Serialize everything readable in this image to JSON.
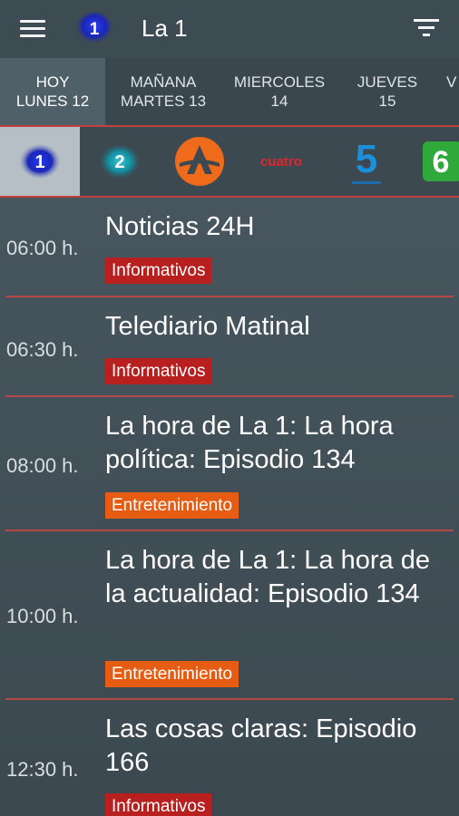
{
  "header": {
    "title": "La 1",
    "logo_number": "1",
    "menu_icon": "hamburger-menu-icon",
    "filter_icon": "filter-icon"
  },
  "day_tabs": [
    {
      "line1": "HOY",
      "line2": "LUNES 12",
      "active": true
    },
    {
      "line1": "MAÑANA",
      "line2": "MARTES 13",
      "active": false
    },
    {
      "line1": "MIERCOLES",
      "line2": "14",
      "active": false
    },
    {
      "line1": "JUEVES",
      "line2": "15",
      "active": false
    },
    {
      "line1": "V",
      "line2": "",
      "active": false
    }
  ],
  "channels": [
    {
      "name": "la1-logo",
      "label": "1",
      "active": true
    },
    {
      "name": "la2-logo",
      "label": "2",
      "active": false
    },
    {
      "name": "antena3-logo",
      "label": "",
      "active": false
    },
    {
      "name": "cuatro-logo",
      "label": "cuatro",
      "active": false
    },
    {
      "name": "telecinco-logo",
      "label": "5",
      "active": false
    },
    {
      "name": "lasexta-logo",
      "label": "6",
      "active": false
    }
  ],
  "programs": [
    {
      "time": "06:00 h.",
      "title": "Noticias 24H",
      "category": "Informativos",
      "type": "info"
    },
    {
      "time": "06:30 h.",
      "title": "Telediario Matinal",
      "category": "Informativos",
      "type": "info"
    },
    {
      "time": "08:00 h.",
      "title": "La hora de La 1: La hora política: Episodio 134",
      "category": "Entretenimiento",
      "type": "ent"
    },
    {
      "time": "10:00 h.",
      "title": "La hora de La 1: La hora de la actualidad: Episodio 134",
      "category": "Entretenimiento",
      "type": "ent"
    },
    {
      "time": "12:30 h.",
      "title": "Las cosas claras: Episodio 166",
      "category": "Informativos",
      "type": "info"
    }
  ],
  "colors": {
    "accent_red": "#c0413c",
    "badge_informativos": "#b81f1f",
    "badge_entretenimiento": "#e65c12",
    "background": "#3b4850"
  }
}
